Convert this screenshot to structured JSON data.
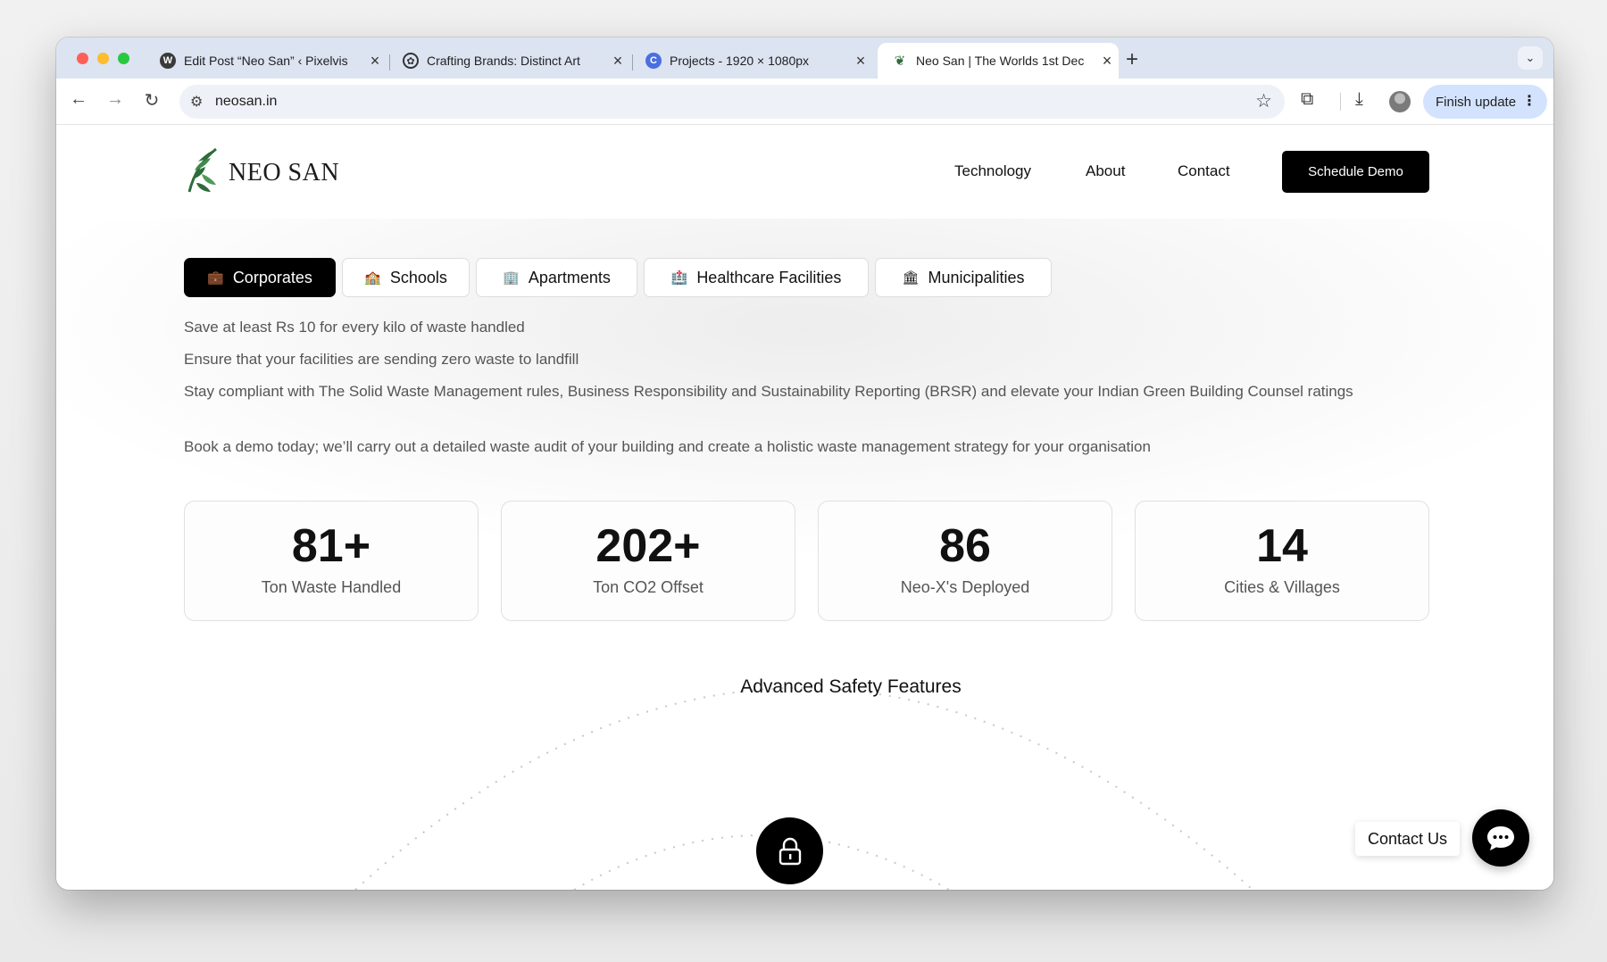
{
  "browser": {
    "tabs": [
      {
        "title": "Edit Post “Neo San” ‹ Pixelvis",
        "favicon": "wordpress-icon",
        "active": false
      },
      {
        "title": "Crafting Brands: Distinct Art",
        "favicon": "openai-icon",
        "active": false
      },
      {
        "title": "Projects - 1920 × 1080px",
        "favicon": "canva-icon",
        "active": false
      },
      {
        "title": "Neo San | The Worlds 1st Dec",
        "favicon": "neosan-leaf-icon",
        "active": true
      }
    ],
    "url": "neosan.in",
    "finish_update_label": "Finish update"
  },
  "site": {
    "logo_text": "NEO SAN",
    "nav": [
      "Technology",
      "About",
      "Contact"
    ],
    "cta_label": "Schedule Demo",
    "segments": [
      {
        "label": "Corporates",
        "icon": "briefcase-icon",
        "active": true
      },
      {
        "label": "Schools",
        "icon": "school-icon",
        "active": false
      },
      {
        "label": "Apartments",
        "icon": "building-icon",
        "active": false
      },
      {
        "label": "Healthcare Facilities",
        "icon": "hospital-icon",
        "active": false
      },
      {
        "label": "Municipalities",
        "icon": "municipality-icon",
        "active": false
      }
    ],
    "bullets": [
      "Save at least Rs 10 for every kilo of waste handled",
      "Ensure that your facilities are sending zero waste to landfill",
      "Stay compliant with The Solid Waste Management rules, Business Responsibility and Sustainability Reporting (BRSR) and elevate your Indian Green Building Counsel ratings",
      "Book a demo today; we’ll carry out a detailed waste audit of your building and create a holistic waste management strategy for your organisation"
    ],
    "stats": [
      {
        "value": "81+",
        "label": "Ton Waste Handled"
      },
      {
        "value": "202+",
        "label": "Ton CO2 Offset"
      },
      {
        "value": "86",
        "label": "Neo-X's Deployed"
      },
      {
        "value": "14",
        "label": "Cities & Villages"
      }
    ],
    "feature_title": "Advanced Safety Features",
    "contact_us_label": "Contact Us"
  },
  "colors": {
    "accent": "#000000",
    "logo_green": "#2f6b3a",
    "tab_strip": "#dce3f1",
    "finish_update_bg": "#d3e3fd"
  }
}
